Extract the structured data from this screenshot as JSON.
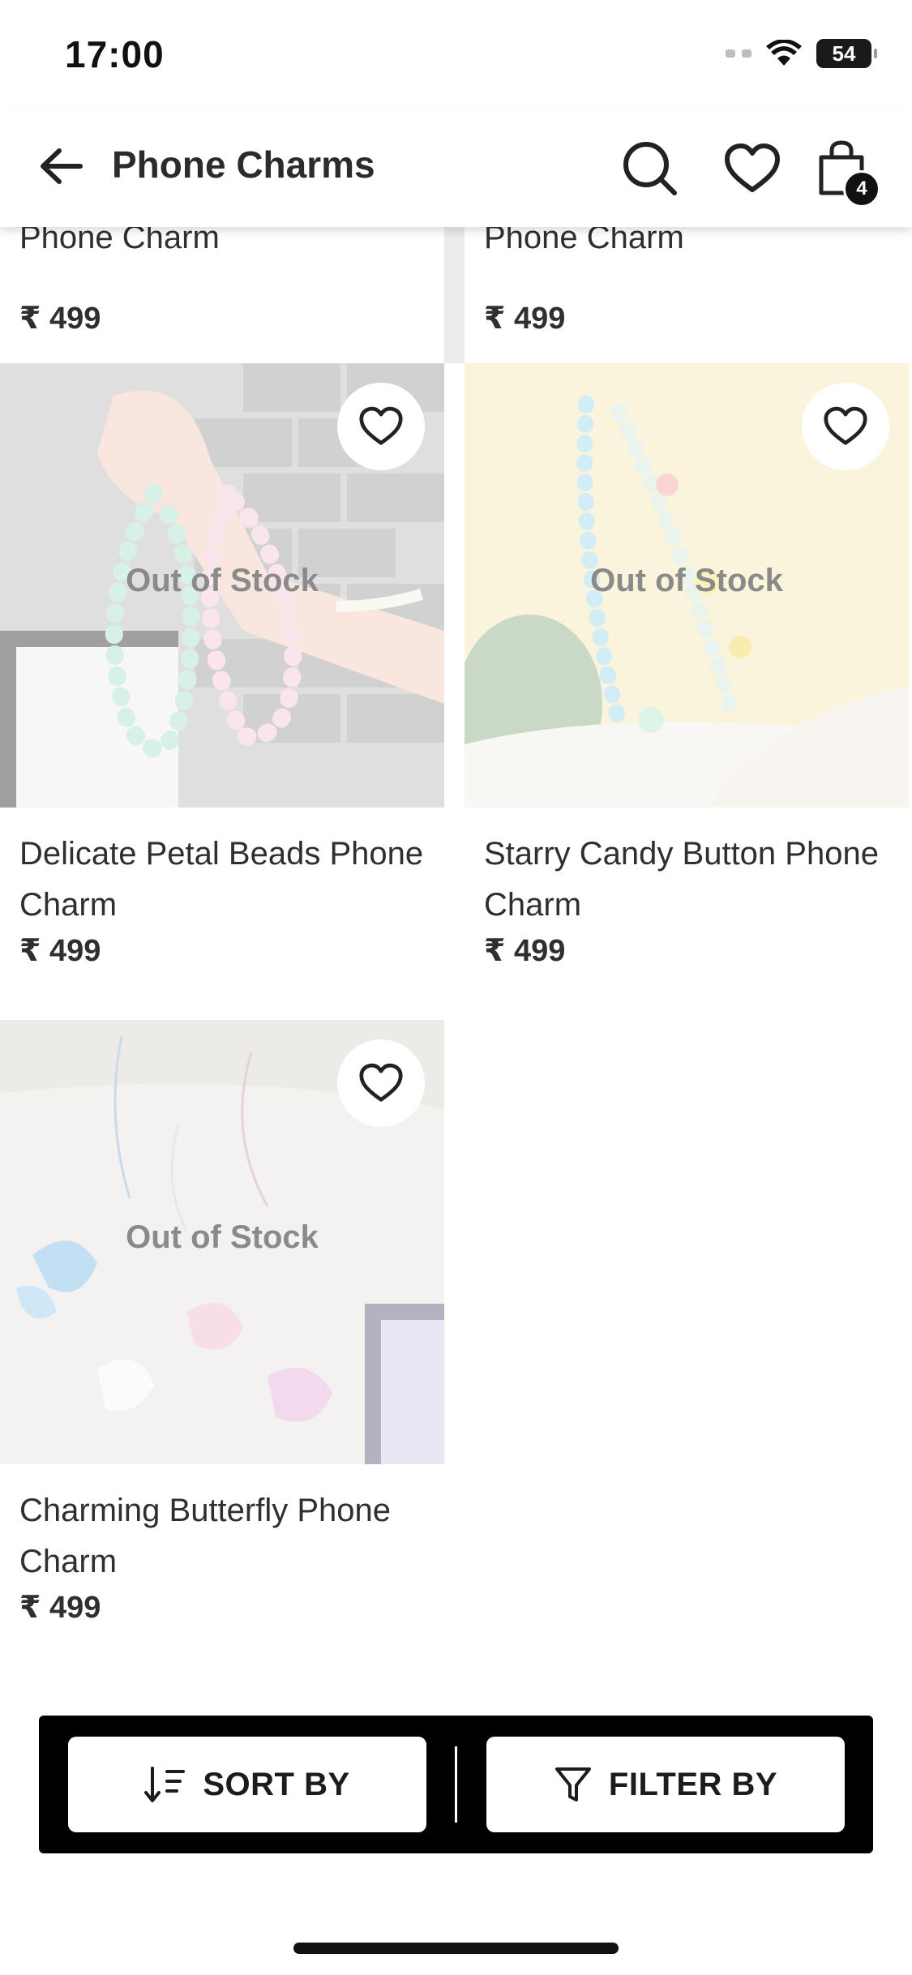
{
  "status_bar": {
    "time": "17:00",
    "battery": "54"
  },
  "header": {
    "title": "Phone Charms",
    "cart_count": "4"
  },
  "partial_row": [
    {
      "name_tail": "Phone Charm",
      "price": "₹ 499"
    },
    {
      "name_tail": "Phone Charm",
      "price": "₹ 499"
    }
  ],
  "products": [
    {
      "name": "Delicate Petal Beads Phone Charm",
      "price": "₹ 499",
      "status": "Out of Stock"
    },
    {
      "name": "Starry Candy Button Phone Charm",
      "price": "₹ 499",
      "status": "Out of Stock"
    },
    {
      "name": "Charming Butterfly Phone Charm",
      "price": "₹ 499",
      "status": "Out of Stock"
    }
  ],
  "bottom_bar": {
    "sort_label": "SORT BY",
    "filter_label": "FILTER BY"
  }
}
